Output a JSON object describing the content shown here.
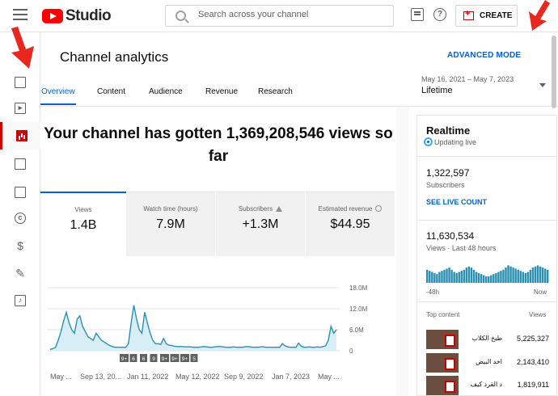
{
  "header": {
    "logo_text": "Studio",
    "search_placeholder": "Search across your channel",
    "create_label": "CREATE"
  },
  "sidebar": {
    "items": [
      {
        "icon": "dashboard-icon"
      },
      {
        "icon": "content-icon"
      },
      {
        "icon": "analytics-icon",
        "active": true
      },
      {
        "icon": "comments-icon"
      },
      {
        "icon": "subtitles-icon"
      },
      {
        "icon": "copyright-icon",
        "glyph": "c"
      },
      {
        "icon": "earn-icon",
        "glyph": "$"
      },
      {
        "icon": "customization-icon",
        "glyph": "✎"
      },
      {
        "icon": "audio-library-icon",
        "glyph": "♪"
      }
    ]
  },
  "page": {
    "title": "Channel analytics",
    "advanced_mode": "ADVANCED MODE",
    "date_range": "May 16, 2021 – May 7, 2023",
    "date_value": "Lifetime"
  },
  "tabs": [
    "Overview",
    "Content",
    "Audience",
    "Revenue",
    "Research"
  ],
  "headline": "Your channel has gotten 1,369,208,546 views so far",
  "metrics": [
    {
      "label": "Views",
      "value": "1.4B"
    },
    {
      "label": "Watch time (hours)",
      "value": "7.9M"
    },
    {
      "label": "Subscribers",
      "value": "+1.3M"
    },
    {
      "label": "Estimated revenue",
      "value": "$44.95"
    }
  ],
  "chart_data": {
    "type": "area",
    "y_ticks": [
      "18.0M",
      "12.0M",
      "6.0M",
      "0"
    ],
    "ylim": [
      0,
      18000000
    ],
    "x_ticks": [
      "May ...",
      "Sep 13, 20...",
      "Jan 11, 2022",
      "May 12, 2022",
      "Sep 9, 2022",
      "Jan 7, 2023",
      "May ..."
    ],
    "markers": [
      "9+",
      "6",
      "6",
      "9",
      "9+",
      "9+",
      "9+",
      "5"
    ],
    "series": [
      {
        "values": [
          0.4,
          0.6,
          1.0,
          3.0,
          5.5,
          8.5,
          11.0,
          8.0,
          6.0,
          5.0,
          9.0,
          10.0,
          7.0,
          5.5,
          4.0,
          3.5,
          3.0,
          5.0,
          4.0,
          3.0,
          2.5,
          2.0,
          1.5,
          1.2,
          1.0,
          1.0,
          1.0,
          1.0,
          1.0,
          2.0,
          8.0,
          13.0,
          9.0,
          6.0,
          5.0,
          11.0,
          8.0,
          5.0,
          3.0,
          2.0,
          2.0,
          1.8,
          3.5,
          2.0,
          1.6,
          1.5,
          1.3,
          1.2,
          1.2,
          1.2,
          1.1,
          1.1,
          1.1,
          1.0,
          1.0,
          1.0,
          1.1,
          1.2,
          1.1,
          1.0,
          1.0,
          1.1,
          1.2,
          1.2,
          1.1,
          1.0,
          1.0,
          1.0,
          1.1,
          1.0,
          1.0,
          1.0,
          1.1,
          1.2,
          1.1,
          1.0,
          1.0,
          1.0,
          1.1,
          1.1,
          1.0,
          1.0,
          1.0,
          1.0,
          1.0,
          1.0,
          2.0,
          1.4,
          1.1,
          1.0,
          1.0,
          1.0,
          2.2,
          1.3,
          1.0,
          1.0,
          1.1,
          1.0,
          1.0,
          1.1,
          1.0,
          1.2,
          1.4,
          3.0,
          7.0,
          5.0,
          6.0
        ]
      }
    ]
  },
  "realtime": {
    "title": "Realtime",
    "status": "Updating live",
    "subscribers_value": "1,322,597",
    "subscribers_label": "Subscribers",
    "see_live": "SEE LIVE COUNT",
    "views_value": "11,630,534",
    "views_label": "Views · Last 48 hours",
    "axis_left": "-48h",
    "axis_right": "Now",
    "bars": [
      0.6,
      0.55,
      0.5,
      0.45,
      0.4,
      0.5,
      0.55,
      0.6,
      0.65,
      0.7,
      0.6,
      0.5,
      0.45,
      0.5,
      0.55,
      0.6,
      0.7,
      0.75,
      0.7,
      0.6,
      0.5,
      0.45,
      0.4,
      0.35,
      0.3,
      0.3,
      0.35,
      0.4,
      0.45,
      0.5,
      0.55,
      0.6,
      0.7,
      0.8,
      0.75,
      0.7,
      0.65,
      0.6,
      0.55,
      0.5,
      0.45,
      0.5,
      0.6,
      0.7,
      0.75,
      0.8,
      0.75,
      0.7,
      0.65,
      0.6
    ],
    "top_content_title": "Top content",
    "top_content_views": "Views",
    "top_content": [
      {
        "name": "طبخ الكلاب",
        "views": "5,225,327"
      },
      {
        "name": "اخد البيض",
        "views": "2,143,410"
      },
      {
        "name": "د القرد كيف",
        "views": "1,819,911"
      }
    ]
  },
  "accent": "#065fd4",
  "brand": "#ff0000"
}
